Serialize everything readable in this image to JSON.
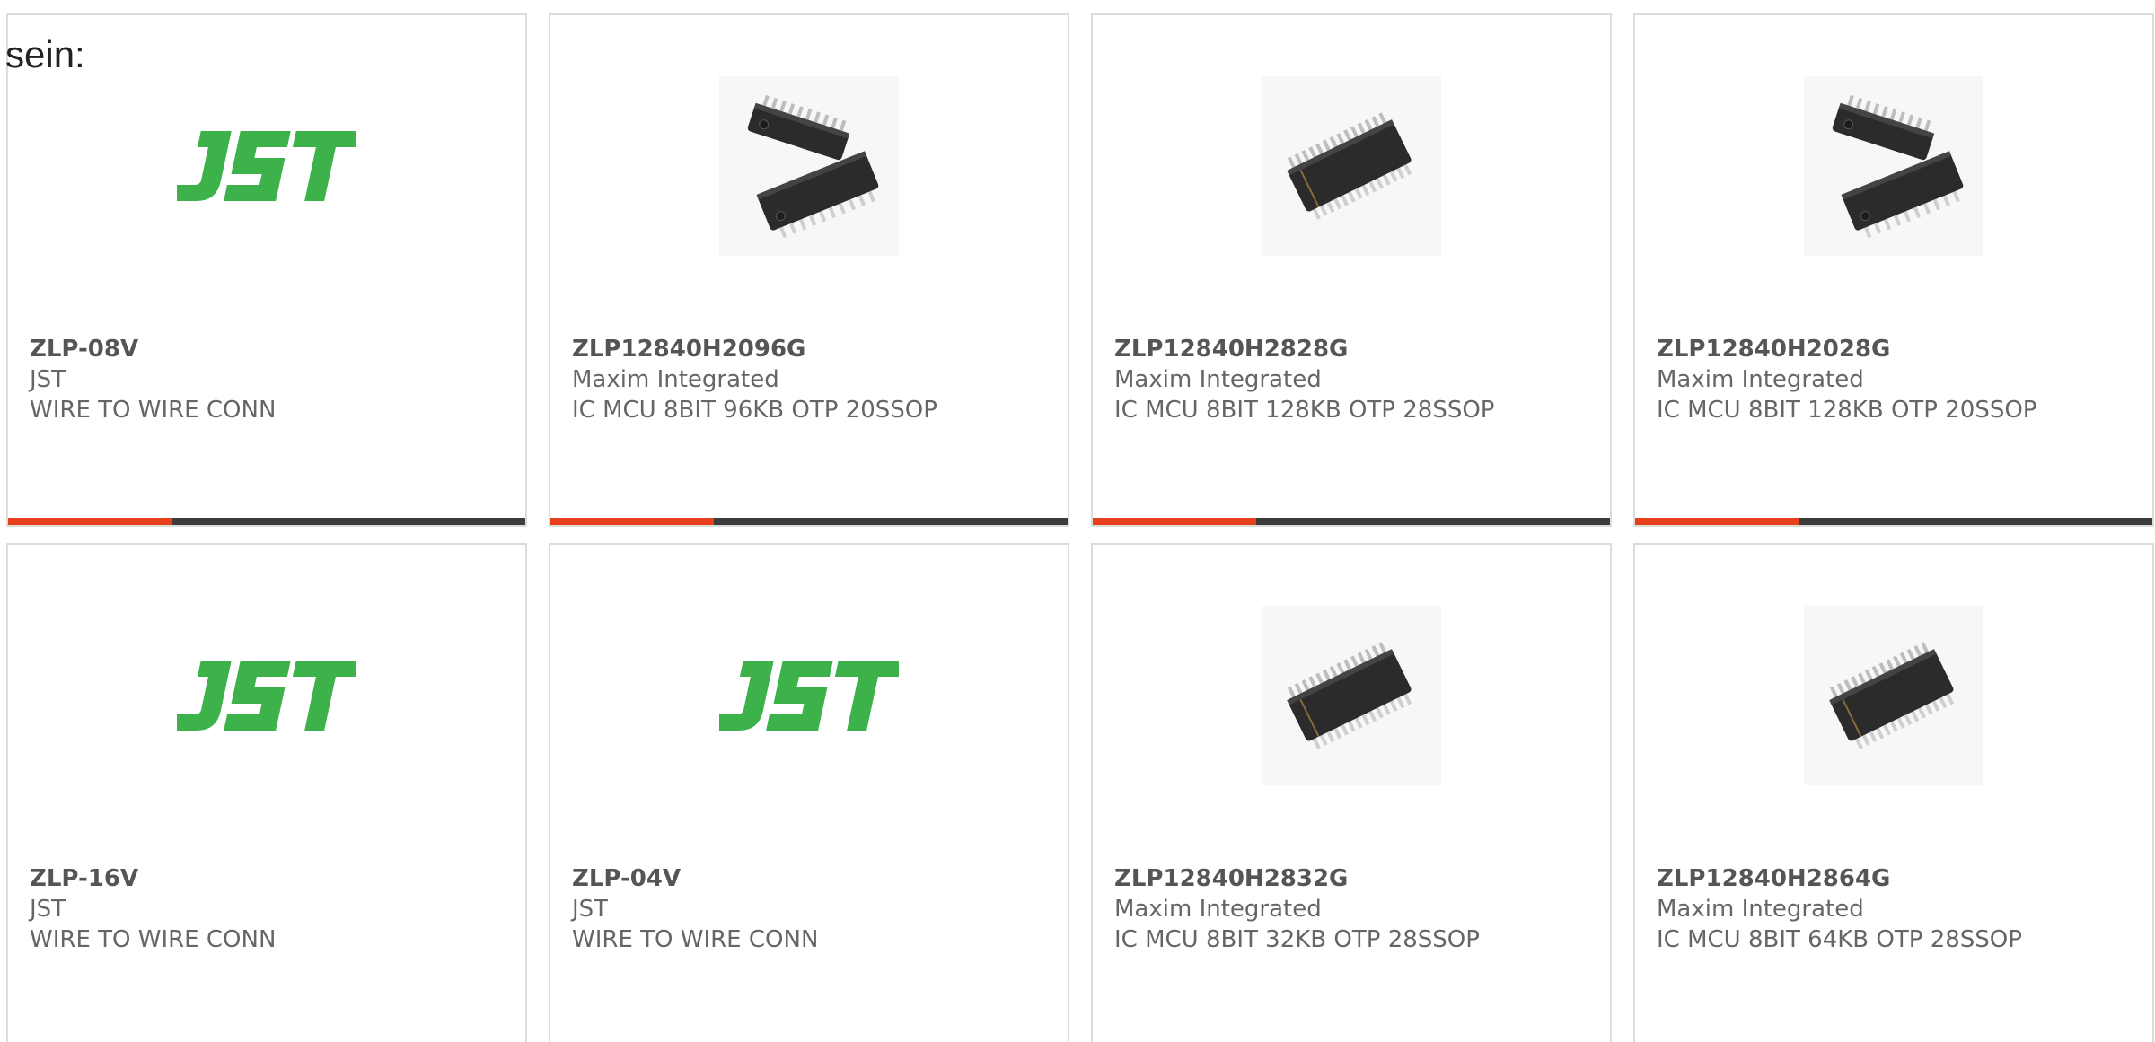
{
  "intro": {
    "text": "sein:"
  },
  "colors": {
    "accent": "#e8401b",
    "bar": "#3c3c3c",
    "jst_green": "#3db24a",
    "card_border": "#dcdcdc"
  },
  "products": [
    {
      "part": "ZLP-08V",
      "maker": "JST",
      "description": "WIRE TO WIRE CONN",
      "image": "jst-logo"
    },
    {
      "part": "ZLP12840H2096G",
      "maker": "Maxim Integrated",
      "description": "IC MCU 8BIT 96KB OTP 20SSOP",
      "image": "ic-two-chips"
    },
    {
      "part": "ZLP12840H2828G",
      "maker": "Maxim Integrated",
      "description": "IC MCU 8BIT 128KB OTP 28SSOP",
      "image": "ic-single-chip"
    },
    {
      "part": "ZLP12840H2028G",
      "maker": "Maxim Integrated",
      "description": "IC MCU 8BIT 128KB OTP 20SSOP",
      "image": "ic-two-chips"
    },
    {
      "part": "ZLP-16V",
      "maker": "JST",
      "description": "WIRE TO WIRE CONN",
      "image": "jst-logo"
    },
    {
      "part": "ZLP-04V",
      "maker": "JST",
      "description": "WIRE TO WIRE CONN",
      "image": "jst-logo"
    },
    {
      "part": "ZLP12840H2832G",
      "maker": "Maxim Integrated",
      "description": "IC MCU 8BIT 32KB OTP 28SSOP",
      "image": "ic-single-chip"
    },
    {
      "part": "ZLP12840H2864G",
      "maker": "Maxim Integrated",
      "description": "IC MCU 8BIT 64KB OTP 28SSOP",
      "image": "ic-single-chip"
    }
  ]
}
